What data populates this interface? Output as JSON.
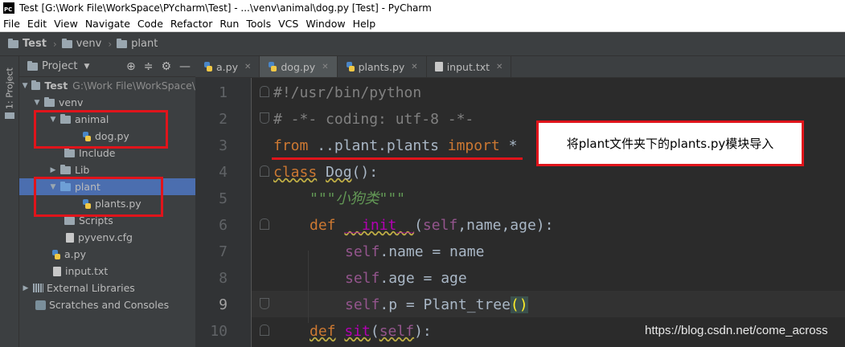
{
  "window": {
    "title": "Test [G:\\Work File\\WorkSpace\\PYcharm\\Test] - ...\\venv\\animal\\dog.py [Test] - PyCharm",
    "logo": "PC"
  },
  "menu": [
    "File",
    "Edit",
    "View",
    "Navigate",
    "Code",
    "Refactor",
    "Run",
    "Tools",
    "VCS",
    "Window",
    "Help"
  ],
  "breadcrumb": [
    "Test",
    "venv",
    "plant"
  ],
  "sidebar_tab": "1: Project",
  "project_panel": {
    "title": "Project",
    "tree": [
      {
        "label": "Test",
        "path": "G:\\Work File\\WorkSpace\\",
        "type": "folder",
        "expanded": true
      },
      {
        "label": "venv",
        "type": "folder",
        "expanded": true
      },
      {
        "label": "animal",
        "type": "folder",
        "expanded": true
      },
      {
        "label": "dog.py",
        "type": "py"
      },
      {
        "label": "Include",
        "type": "folder"
      },
      {
        "label": "Lib",
        "type": "folder",
        "expanded": false
      },
      {
        "label": "plant",
        "type": "folder",
        "expanded": true,
        "selected": true
      },
      {
        "label": "plants.py",
        "type": "py"
      },
      {
        "label": "Scripts",
        "type": "folder"
      },
      {
        "label": "pyvenv.cfg",
        "type": "file"
      },
      {
        "label": "a.py",
        "type": "py"
      },
      {
        "label": "input.txt",
        "type": "file"
      },
      {
        "label": "External Libraries",
        "type": "lib"
      },
      {
        "label": "Scratches and Consoles",
        "type": "scratch"
      }
    ]
  },
  "tabs": [
    {
      "label": "a.py",
      "active": false
    },
    {
      "label": "dog.py",
      "active": true
    },
    {
      "label": "plants.py",
      "active": false
    },
    {
      "label": "input.txt",
      "active": false
    }
  ],
  "code": {
    "line_numbers": [
      "1",
      "2",
      "3",
      "4",
      "5",
      "6",
      "7",
      "8",
      "9",
      "10"
    ],
    "current_line": "9",
    "l1": "#!/usr/bin/python",
    "l2": "# -*- coding: utf-8 -*-",
    "l3_kw1": "from",
    "l3_mod": " ..plant.plants ",
    "l3_kw2": "import",
    "l3_rest": " *",
    "l4_kw": "class",
    "l4_name": "Dog",
    "l4_rest": "():",
    "l5": "\"\"\"小狗类\"\"\"",
    "l6_kw": "def",
    "l6_fn": "__init__",
    "l6_open": "(",
    "l6_self": "self",
    "l6_rest": ",name,age):",
    "l7_self": "self",
    "l7_rest": ".name = name",
    "l8_self": "self",
    "l8_rest": ".age = age",
    "l9_self": "self",
    "l9_rest": ".p = Plant_tree",
    "l9_paren": "()",
    "l10_kw": "def",
    "l10_name": "sit",
    "l10_open": "(",
    "l10_self": "self",
    "l10_rest": "):"
  },
  "annotation": "将plant文件夹下的plants.py模块导入",
  "watermark": "https://blog.csdn.net/come_across",
  "colors": {
    "highlight": "#e0141b",
    "selection": "#4b6eaf"
  }
}
